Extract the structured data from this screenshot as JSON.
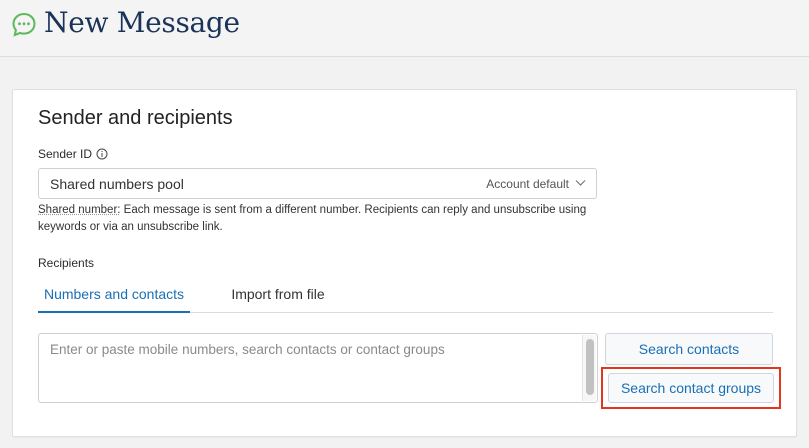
{
  "header": {
    "title": "New Message",
    "icon": "chat-bubble-icon",
    "icon_color": "#5cb85c"
  },
  "card": {
    "section_title": "Sender and recipients",
    "sender": {
      "label": "Sender ID",
      "value": "Shared numbers pool",
      "default_tag": "Account default",
      "help_strong": "Shared number:",
      "help_text": " Each message is sent from a different number. Recipients can reply and unsubscribe using keywords or via an unsubscribe link."
    },
    "recipients": {
      "label": "Recipients",
      "tabs": [
        {
          "label": "Numbers and contacts",
          "active": true
        },
        {
          "label": "Import from file",
          "active": false
        }
      ],
      "placeholder": "Enter or paste mobile numbers, search contacts or contact groups",
      "search_contacts_label": "Search contacts",
      "search_groups_label": "Search contact groups"
    }
  },
  "colors": {
    "accent": "#1a6fb5",
    "title": "#1a3358",
    "highlight": "#e2361f"
  }
}
